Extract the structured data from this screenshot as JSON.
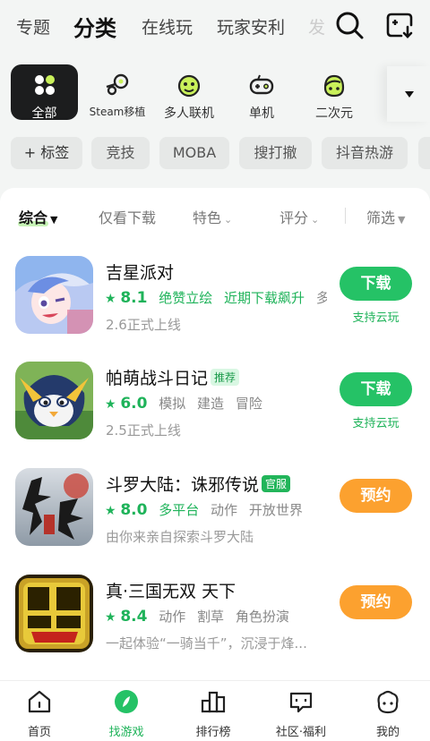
{
  "top_tabs": [
    {
      "label": "专题"
    },
    {
      "label": "分类"
    },
    {
      "label": "在线玩"
    },
    {
      "label": "玩家安利"
    },
    {
      "label": "发"
    }
  ],
  "top_icons": {
    "search": "search-icon",
    "gamepad_download": "gamepad-download-icon"
  },
  "categories": [
    {
      "label": "全部",
      "icon": "grid-icon"
    },
    {
      "label": "Steam移植",
      "icon": "steam-icon"
    },
    {
      "label": "多人联机",
      "icon": "multiplayer-icon"
    },
    {
      "label": "单机",
      "icon": "gamepad-icon"
    },
    {
      "label": "二次元",
      "icon": "anime-icon"
    }
  ],
  "chips": [
    "+ 标签",
    "竞技",
    "MOBA",
    "搜打撤",
    "抖音热游"
  ],
  "filters": [
    {
      "label": "综合"
    },
    {
      "label": "仅看下载"
    },
    {
      "label": "特色"
    },
    {
      "label": "评分"
    },
    {
      "label": "筛选"
    }
  ],
  "games": [
    {
      "name": "吉星派对",
      "badge": "",
      "score": "8.1",
      "tags": [
        "绝赞立绘",
        "近期下载飙升",
        "多人..."
      ],
      "sub": "2.6正式上线",
      "button": "下载",
      "cloud": "支持云玩"
    },
    {
      "name": "帕萌战斗日记",
      "badge": "推荐",
      "score": "6.0",
      "tags": [
        "模拟",
        "建造",
        "冒险"
      ],
      "sub": "2.5正式上线",
      "button": "下载",
      "cloud": "支持云玩"
    },
    {
      "name": "斗罗大陆：诛邪传说",
      "badge": "官服",
      "score": "8.0",
      "tags": [
        "多平台",
        "动作",
        "开放世界"
      ],
      "sub": "由你来亲自探索斗罗大陆",
      "button": "预约",
      "cloud": ""
    },
    {
      "name": "真·三国无双 天下",
      "badge": "",
      "score": "8.4",
      "tags": [
        "动作",
        "割草",
        "角色扮演"
      ],
      "sub": "一起体验“一骑当千”，沉浸于烽...",
      "button": "预约",
      "cloud": ""
    }
  ],
  "bottom_nav": [
    {
      "label": "首页",
      "icon": "home-icon"
    },
    {
      "label": "找游戏",
      "icon": "compass-icon"
    },
    {
      "label": "排行榜",
      "icon": "ranking-icon"
    },
    {
      "label": "社区·福利",
      "icon": "community-icon"
    },
    {
      "label": "我的",
      "icon": "profile-icon"
    }
  ],
  "colors": {
    "accent": "#25c266",
    "reserve": "#fca12f",
    "active_dark": "#1c1d1e"
  }
}
